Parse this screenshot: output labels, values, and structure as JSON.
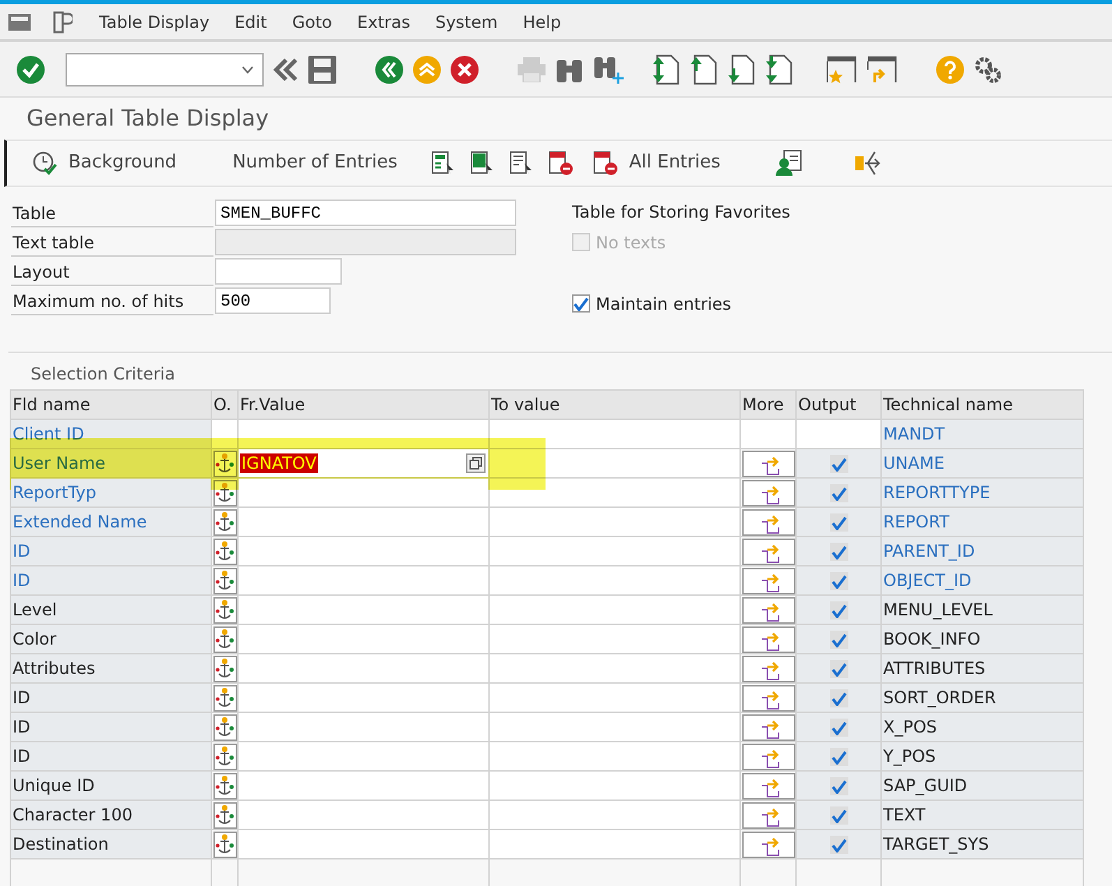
{
  "menu": [
    "Table Display",
    "Edit",
    "Goto",
    "Extras",
    "System",
    "Help"
  ],
  "title": "General Table Display",
  "app_toolbar": [
    {
      "kind": "icon-text",
      "label": "Background"
    },
    {
      "kind": "text",
      "label": "Number of Entries"
    },
    {
      "kind": "icon-text",
      "label": "All Entries"
    }
  ],
  "form": {
    "fields": [
      {
        "label": "Table",
        "value": "SMEN_BUFFC",
        "disabled": false
      },
      {
        "label": "Text table",
        "disabled": true
      },
      {
        "label": "Layout",
        "disabled": false
      },
      {
        "label": "Maximum no. of hits",
        "value": "500",
        "disabled": false
      }
    ],
    "side_title": "Table for Storing Favorites",
    "checkboxes": [
      {
        "label": "No texts",
        "checked": false,
        "disabled": true
      },
      {
        "label": "Maintain entries",
        "checked": true,
        "disabled": false
      }
    ]
  },
  "selection": {
    "title": "Selection Criteria",
    "columns": [
      "Fld name",
      "O.",
      "Fr.Value",
      "To value",
      "More",
      "Output",
      "Technical name"
    ],
    "rows": [
      {
        "kind": "fixed",
        "name": "Client ID",
        "key": true,
        "technical": "MANDT"
      },
      {
        "kind": "criteria",
        "name": "User Name",
        "key": true,
        "technical": "UNAME",
        "from": "IGNATOV",
        "error": true,
        "focused": true,
        "highlighted": true,
        "output": true
      },
      {
        "kind": "criteria",
        "name": "ReportTyp",
        "key": true,
        "technical": "REPORTTYPE",
        "output": true
      },
      {
        "kind": "criteria",
        "name": "Extended Name",
        "key": true,
        "technical": "REPORT",
        "output": true
      },
      {
        "kind": "criteria",
        "name": "ID",
        "key": true,
        "technical": "PARENT_ID",
        "output": true
      },
      {
        "kind": "criteria",
        "name": "ID",
        "key": true,
        "technical": "OBJECT_ID",
        "output": true
      },
      {
        "kind": "criteria",
        "name": "Level",
        "key": false,
        "technical": "MENU_LEVEL",
        "output": true
      },
      {
        "kind": "criteria",
        "name": "Color",
        "key": false,
        "technical": "BOOK_INFO",
        "output": true
      },
      {
        "kind": "criteria",
        "name": "Attributes",
        "key": false,
        "technical": "ATTRIBUTES",
        "output": true
      },
      {
        "kind": "criteria",
        "name": "ID",
        "key": false,
        "technical": "SORT_ORDER",
        "output": true
      },
      {
        "kind": "criteria",
        "name": "ID",
        "key": false,
        "technical": "X_POS",
        "output": true
      },
      {
        "kind": "criteria",
        "name": "ID",
        "key": false,
        "technical": "Y_POS",
        "output": true
      },
      {
        "kind": "criteria",
        "name": "Unique ID",
        "key": false,
        "technical": "SAP_GUID",
        "output": true
      },
      {
        "kind": "criteria",
        "name": "Character 100",
        "key": false,
        "technical": "TEXT",
        "output": true
      },
      {
        "kind": "criteria",
        "name": "Destination",
        "key": false,
        "technical": "TARGET_SYS",
        "output": true
      }
    ]
  }
}
